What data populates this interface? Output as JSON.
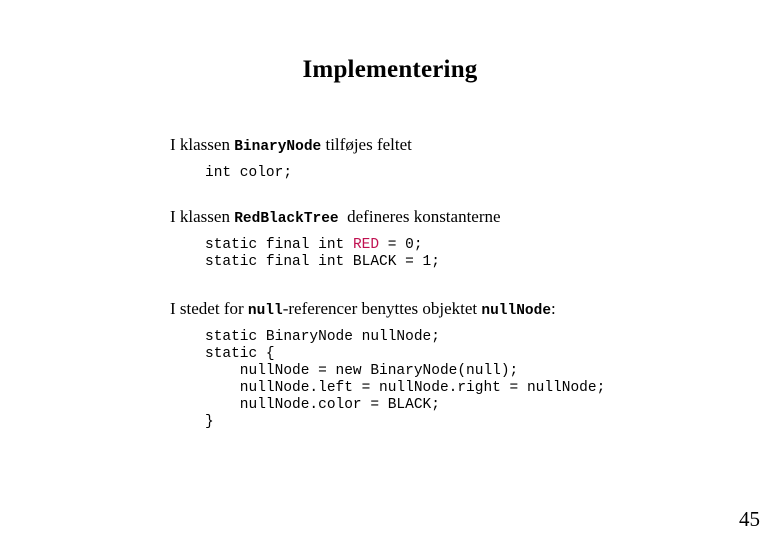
{
  "slide": {
    "title": "Implementering",
    "page_number": "45",
    "sections": [
      {
        "id": "binarynode",
        "text_before": "I klassen ",
        "code_term": "BinaryNode",
        "text_after": " tilføjes feltet",
        "code_lines": [
          "int color;"
        ]
      },
      {
        "id": "redblacktree",
        "text_before": "I klassen ",
        "code_term": "RedBlackTree",
        "text_after": "  defineres konstanterne",
        "code_lines": [
          "static final int RED = 0;",
          "static final int BLACK = 1;"
        ],
        "code_line1_pre": "static final int ",
        "code_line1_token": "RED",
        "code_line1_post": " = 0;",
        "code_line2": "static final int BLACK = 1;"
      },
      {
        "id": "nullnode",
        "text_before": "I stedet for ",
        "code_term": "null",
        "text_middle": "-referencer benyttes objektet ",
        "code_term2": "nullNode",
        "text_after": ":",
        "code_lines": [
          "static BinaryNode nullNode;",
          "static {",
          "    nullNode = new BinaryNode(null);",
          "    nullNode.left = nullNode.right = nullNode;",
          "    nullNode.color = BLACK;",
          "}"
        ],
        "code_text": "static BinaryNode nullNode;\nstatic {\n    nullNode = new BinaryNode(null);\n    nullNode.left = nullNode.right = nullNode;\n    nullNode.color = BLACK;\n}"
      }
    ]
  },
  "colors": {
    "background": "#ffffff",
    "text": "#000000",
    "red_keyword": "#C01050"
  }
}
